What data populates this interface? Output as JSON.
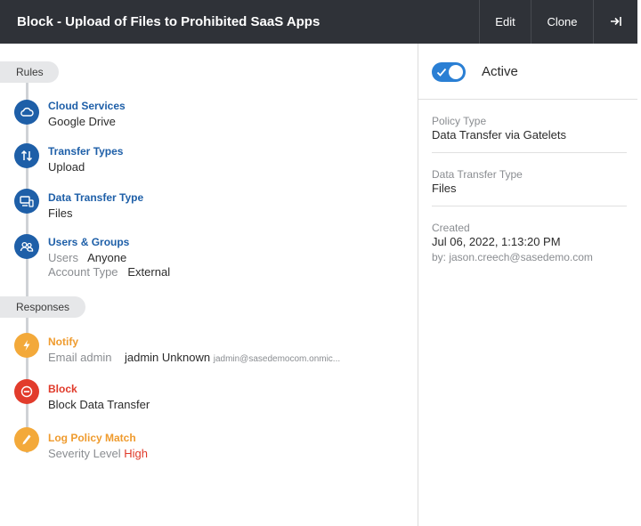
{
  "header": {
    "title": "Block - Upload of Files to Prohibited SaaS Apps",
    "edit_label": "Edit",
    "clone_label": "Clone"
  },
  "rules": {
    "section_label": "Rules",
    "cloud_services": {
      "label": "Cloud Services",
      "value": "Google Drive",
      "icon": "cloud-icon"
    },
    "transfer_types": {
      "label": "Transfer Types",
      "value": "Upload",
      "icon": "transfer-arrows-icon"
    },
    "data_transfer_type": {
      "label": "Data Transfer Type",
      "value": "Files",
      "icon": "devices-icon"
    },
    "users_groups": {
      "label": "Users & Groups",
      "icon": "users-icon",
      "users_key": "Users",
      "users_value": "Anyone",
      "account_type_key": "Account Type",
      "account_type_value": "External"
    }
  },
  "responses": {
    "section_label": "Responses",
    "notify": {
      "label": "Notify",
      "icon": "lightning-icon",
      "email_key": "Email admin",
      "email_name": "jadmin Unknown",
      "email_address": "jadmin@sasedemocom.onmic..."
    },
    "block": {
      "label": "Block",
      "value": "Block Data Transfer",
      "icon": "no-entry-icon"
    },
    "log": {
      "label": "Log Policy Match",
      "icon": "pencil-icon",
      "severity_key": "Severity Level",
      "severity_value": "High"
    }
  },
  "details": {
    "active_label": "Active",
    "active": true,
    "policy_type_key": "Policy Type",
    "policy_type_value": "Data Transfer via Gatelets",
    "data_transfer_type_key": "Data Transfer Type",
    "data_transfer_type_value": "Files",
    "created_key": "Created",
    "created_value": "Jul 06, 2022, 1:13:20 PM",
    "created_by": "by: jason.creech@sasedemo.com"
  },
  "colors": {
    "header_bg": "#2f3238",
    "rule_blue": "#1e5fa8",
    "notify_orange": "#f3a93a",
    "block_red": "#e23c2c",
    "toggle_blue": "#2a7fd4"
  }
}
